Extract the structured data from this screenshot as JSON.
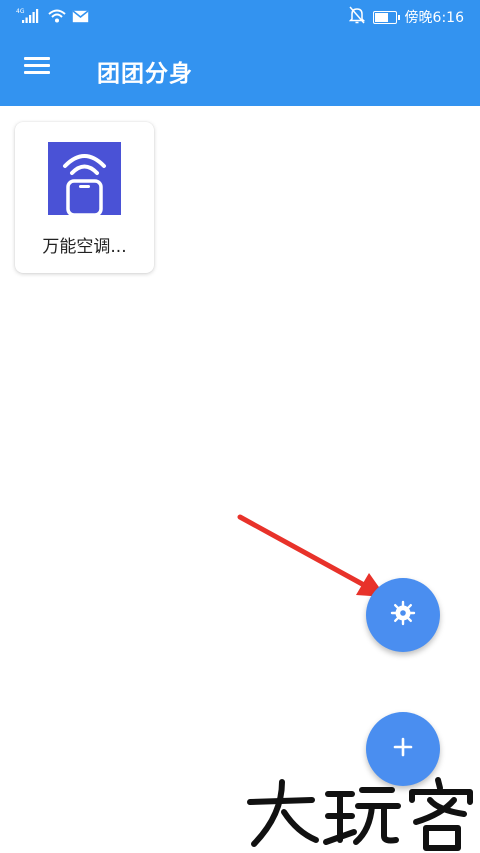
{
  "status_bar": {
    "network": "4G",
    "time": "傍晚6:16",
    "battery_level": 0.6
  },
  "app_bar": {
    "title": "团团分身",
    "menu_icon": "hamburger-menu-icon"
  },
  "apps": [
    {
      "label": "万能空调...",
      "icon": "wifi-phone-icon",
      "icon_bg": "#4a52d6"
    }
  ],
  "fabs": {
    "settings_icon": "gear-icon",
    "add_icon": "plus-icon",
    "color": "#4a8ef0"
  },
  "annotation": {
    "arrow_color": "#e8322a"
  },
  "watermark": {
    "text": "大玩客"
  },
  "colors": {
    "primary": "#3393f0"
  }
}
